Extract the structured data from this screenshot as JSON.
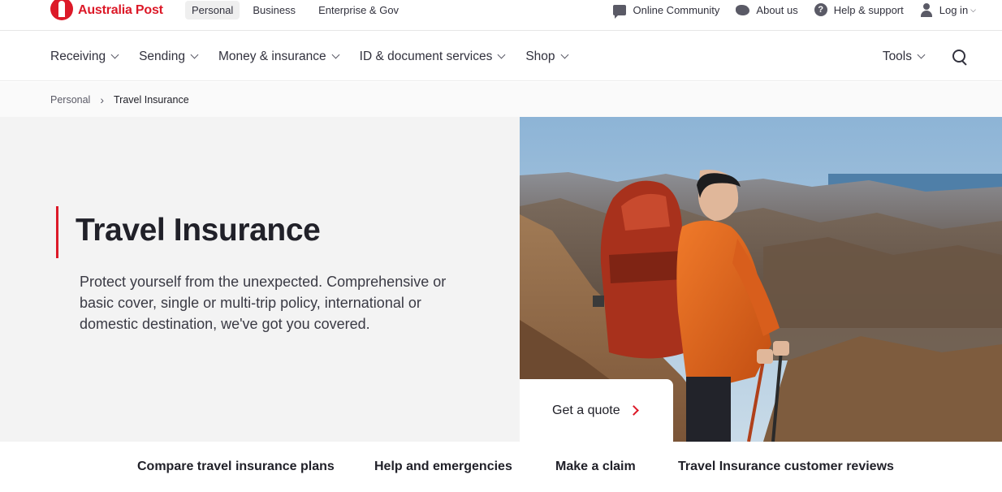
{
  "brand": {
    "name": "Australia Post",
    "color": "#dc1928"
  },
  "segments": [
    {
      "label": "Personal",
      "active": true
    },
    {
      "label": "Business",
      "active": false
    },
    {
      "label": "Enterprise & Gov",
      "active": false
    }
  ],
  "utility_links": {
    "community": "Online Community",
    "about": "About us",
    "help": "Help & support",
    "login": "Log in"
  },
  "main_nav": {
    "items": [
      "Receiving",
      "Sending",
      "Money & insurance",
      "ID & document services",
      "Shop"
    ],
    "tools": "Tools"
  },
  "breadcrumb": {
    "parent": "Personal",
    "current": "Travel Insurance"
  },
  "hero": {
    "title": "Travel Insurance",
    "description": "Protect yourself from the unexpected. Comprehensive or basic cover, single or multi-trip policy, international or domestic destination, we've got you covered.",
    "cta": "Get a quote"
  },
  "bottom_tabs": [
    "Compare travel insurance plans",
    "Help and emergencies",
    "Make a claim",
    "Travel Insurance customer reviews"
  ],
  "icons": {
    "community": "chat-bubble-icon",
    "about": "australia-map-icon",
    "help": "question-circle-icon",
    "login": "user-icon",
    "search": "search-icon"
  }
}
